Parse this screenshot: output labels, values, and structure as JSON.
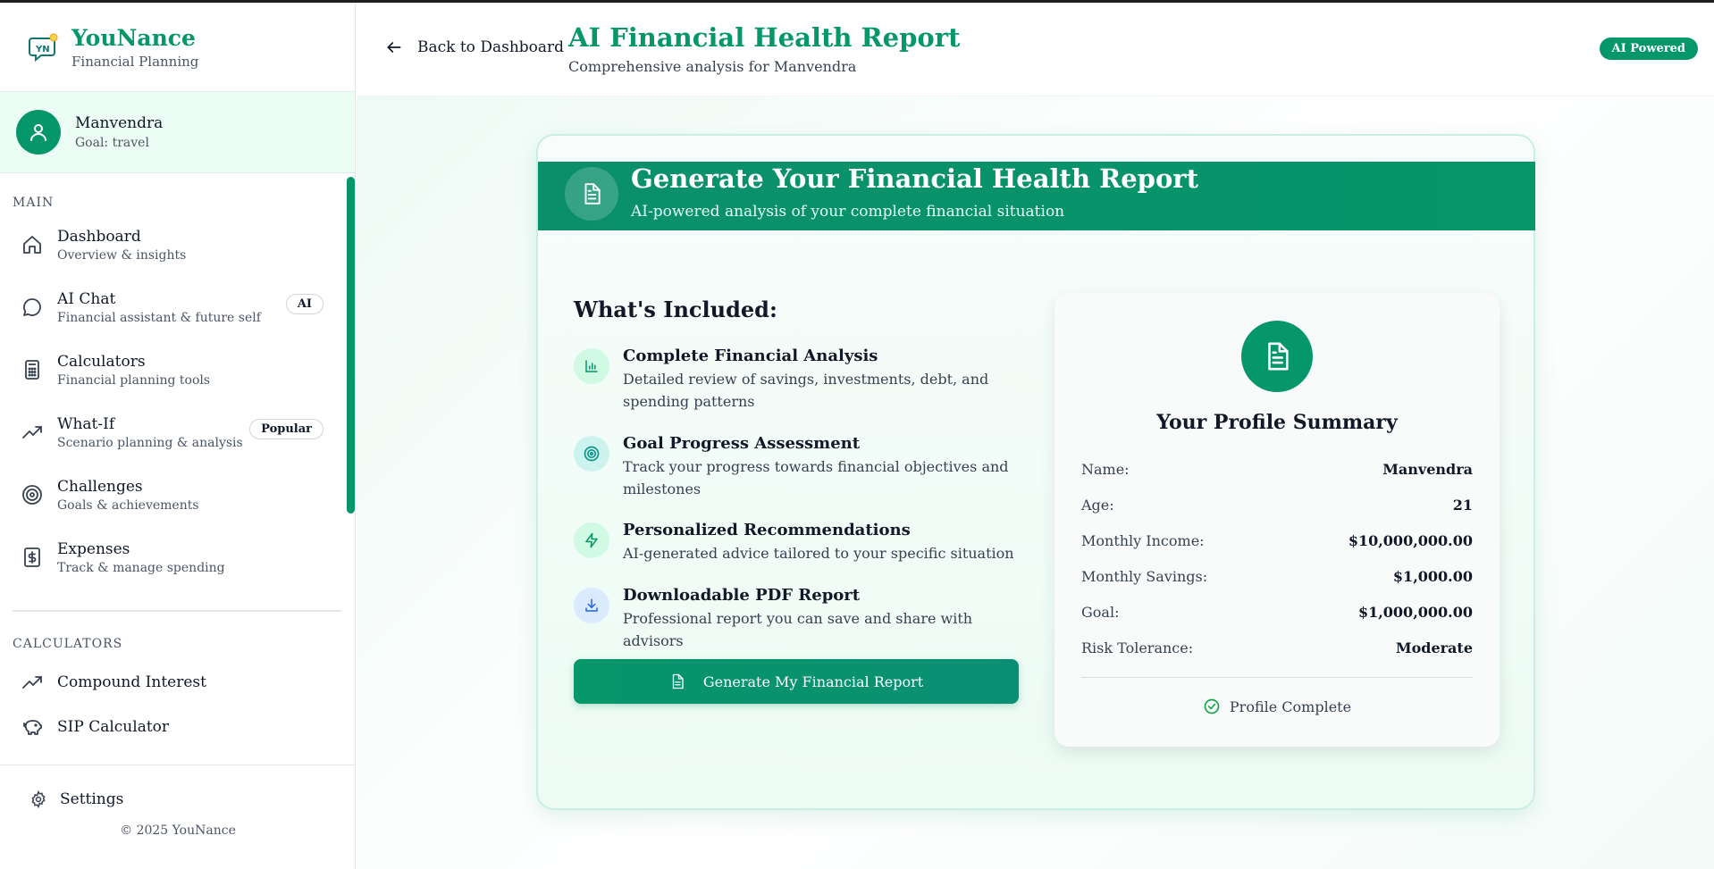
{
  "app": {
    "name": "YouNance",
    "tagline": "Financial Planning",
    "logo_text": "YN"
  },
  "user": {
    "name": "Manvendra",
    "goal": "Goal: travel"
  },
  "sidebar": {
    "main_title": "MAIN",
    "items": [
      {
        "label": "Dashboard",
        "desc": "Overview & insights",
        "icon": "home-icon"
      },
      {
        "label": "AI Chat",
        "desc": "Financial assistant & future self",
        "icon": "chat-icon",
        "badge": "AI"
      },
      {
        "label": "Calculators",
        "desc": "Financial planning tools",
        "icon": "calculator-icon"
      },
      {
        "label": "What-If",
        "desc": "Scenario planning & analysis",
        "icon": "trending-up-icon",
        "badge": "Popular"
      },
      {
        "label": "Challenges",
        "desc": "Goals & achievements",
        "icon": "target-icon"
      },
      {
        "label": "Expenses",
        "desc": "Track & manage spending",
        "icon": "receipt-dollar-icon"
      }
    ],
    "calc_title": "CALCULATORS",
    "calc_items": [
      {
        "label": "Compound Interest",
        "icon": "trending-up-icon"
      },
      {
        "label": "SIP Calculator",
        "icon": "piggy-bank-icon"
      }
    ],
    "settings_label": "Settings",
    "copyright": "© 2025 YouNance"
  },
  "header": {
    "back_label": "Back to Dashboard",
    "title": "AI Financial Health Report",
    "subtitle": "Comprehensive analysis for Manvendra",
    "badge": "AI Powered"
  },
  "report": {
    "banner_title": "Generate Your Financial Health Report",
    "banner_sub": "AI-powered analysis of your complete financial situation",
    "included_title": "What's Included:",
    "features": [
      {
        "title": "Complete Financial Analysis",
        "desc": "Detailed review of savings, investments, debt, and spending patterns",
        "icon": "bar-chart-icon"
      },
      {
        "title": "Goal Progress Assessment",
        "desc": "Track your progress towards financial objectives and milestones",
        "icon": "target-icon"
      },
      {
        "title": "Personalized Recommendations",
        "desc": "AI-generated advice tailored to your specific situation",
        "icon": "lightning-icon"
      },
      {
        "title": "Downloadable PDF Report",
        "desc": "Professional report you can save and share with advisors",
        "icon": "download-icon"
      }
    ],
    "generate_label": "Generate My Financial Report"
  },
  "profile": {
    "title": "Your Profile Summary",
    "rows": [
      {
        "key": "Name:",
        "value": "Manvendra"
      },
      {
        "key": "Age:",
        "value": "21"
      },
      {
        "key": "Monthly Income:",
        "value": "$10,000,000.00"
      },
      {
        "key": "Monthly Savings:",
        "value": "$1,000.00"
      },
      {
        "key": "Goal:",
        "value": "$1,000,000.00"
      },
      {
        "key": "Risk Tolerance:",
        "value": "Moderate"
      }
    ],
    "status": "Profile Complete"
  },
  "colors": {
    "brand": "#059669",
    "brand_light": "#ecfdf5"
  }
}
